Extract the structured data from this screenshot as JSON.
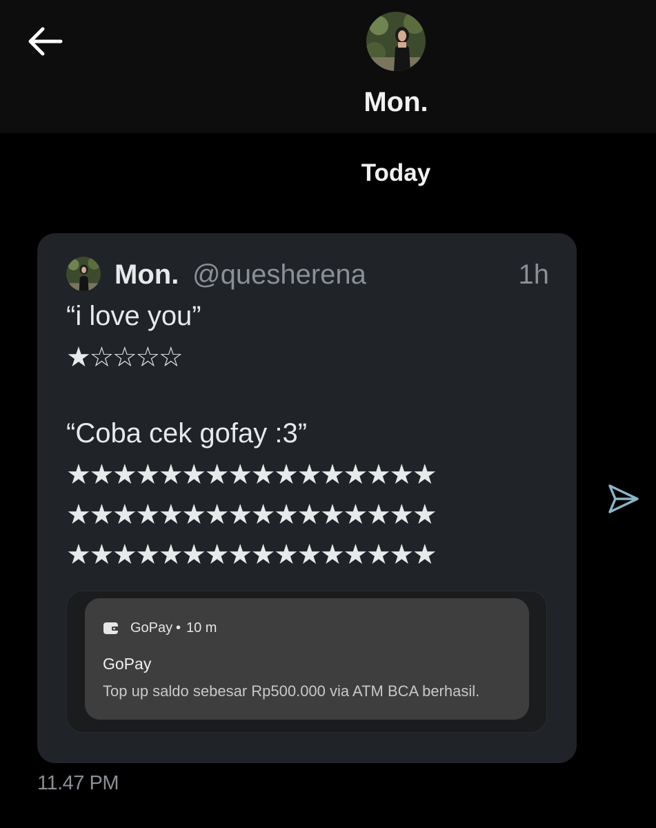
{
  "header": {
    "back_icon": "arrow-left-icon",
    "contact_name": "Mon."
  },
  "conversation": {
    "day_label": "Today"
  },
  "shared_post": {
    "author_name": "Mon.",
    "author_handle": "@quesherena",
    "time": "1h",
    "quote_1": "“i love you”",
    "rating_1": "★☆☆☆☆",
    "quote_2": "“Coba cek gofay :3”",
    "stars_rows": [
      "★★★★★★★★★★★★★★★★",
      "★★★★★★★★★★★★★★★★",
      "★★★★★★★★★★★★★★★★"
    ],
    "notification": {
      "app_icon": "wallet-icon",
      "app_name": "GoPay",
      "separator": "•",
      "time": "10 m",
      "title": "GoPay",
      "body": "Top up saldo sebesar Rp500.000 via ATM BCA berhasil."
    }
  },
  "message": {
    "share_icon": "send-icon",
    "timestamp": "11.47 PM"
  },
  "colors": {
    "background": "#000000",
    "header_background": "#0d0d0d",
    "card_background": "#202327",
    "secondary_text": "#8b9096",
    "share_icon": "#8ab4c8"
  }
}
